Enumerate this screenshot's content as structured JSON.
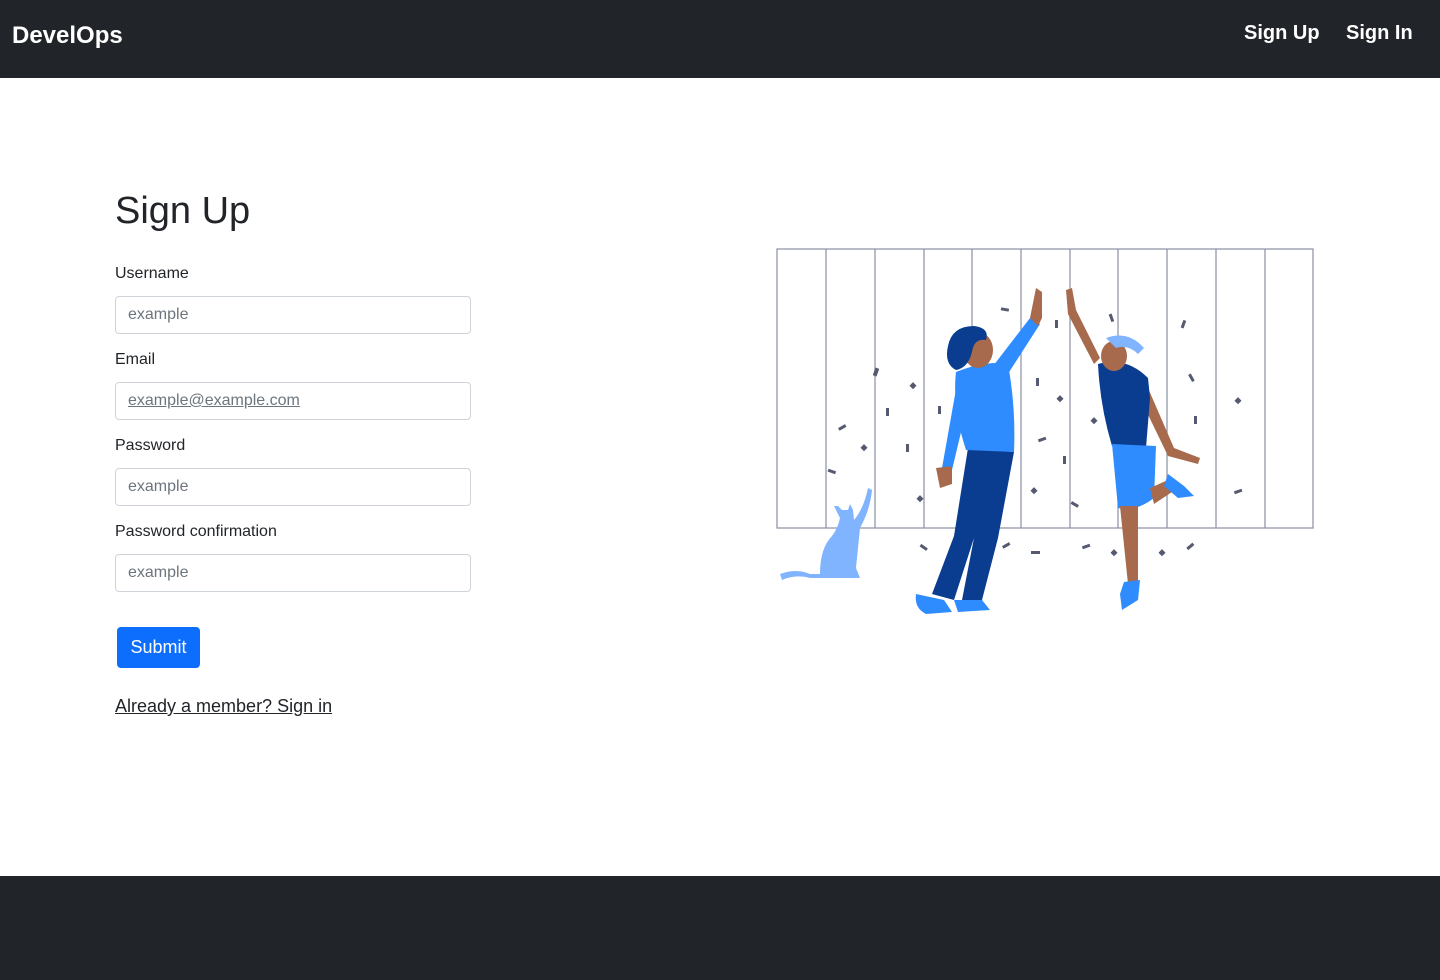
{
  "navbar": {
    "brand": "DevelOps",
    "links": [
      {
        "label": "Sign Up"
      },
      {
        "label": "Sign In"
      }
    ]
  },
  "form": {
    "title": "Sign Up",
    "fields": [
      {
        "label": "Username",
        "placeholder": "example",
        "value": ""
      },
      {
        "label": "Email",
        "placeholder": "example@example.com",
        "value": ""
      },
      {
        "label": "Password",
        "placeholder": "example",
        "value": ""
      },
      {
        "label": "Password confirmation",
        "placeholder": "example",
        "value": ""
      }
    ],
    "submit_label": "Submit",
    "signin_link": "Already a member? Sign in"
  },
  "illustration": {
    "icon": "high-five-celebration-illustration",
    "colors": {
      "frame": "#8a8fa3",
      "light_blue": "#2f8cff",
      "dark_blue": "#0a3d8f",
      "pale_blue": "#80b4ff",
      "skin": "#a86a4c",
      "confetti": "#555a70"
    }
  },
  "colors": {
    "navbar_bg": "#212529",
    "primary": "#0d6efd",
    "footer_bg": "#212529"
  }
}
